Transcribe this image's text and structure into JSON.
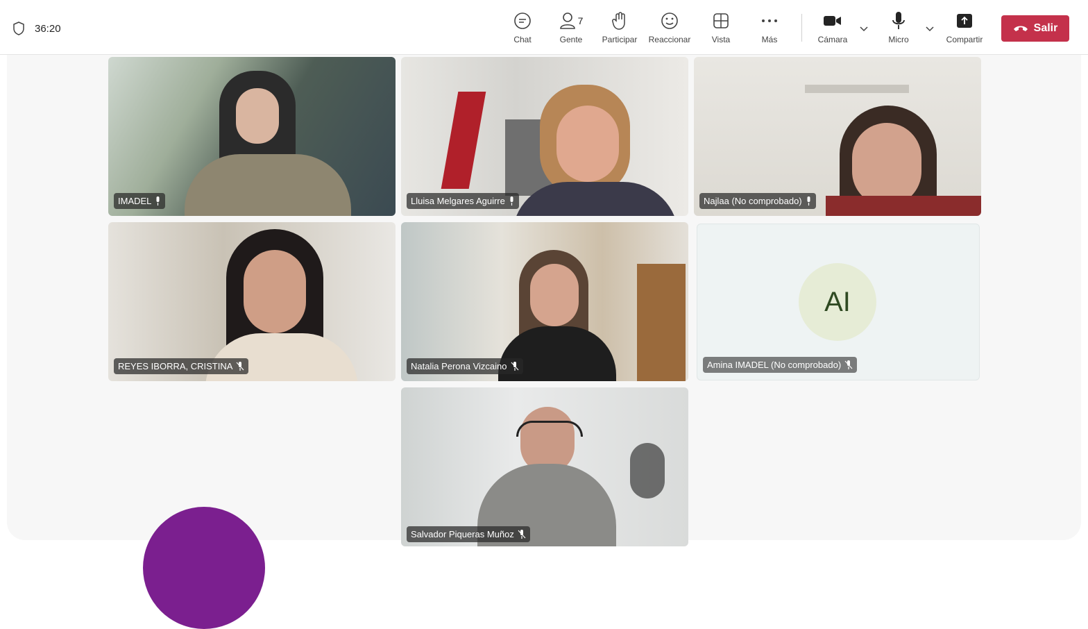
{
  "meeting": {
    "timer": "36:20"
  },
  "toolbar": {
    "chat_label": "Chat",
    "people_label": "Gente",
    "people_count": "7",
    "raise_label": "Participar",
    "react_label": "Reaccionar",
    "view_label": "Vista",
    "more_label": "Más",
    "camera_label": "Cámara",
    "mic_label": "Micro",
    "share_label": "Compartir",
    "leave_label": "Salir"
  },
  "participants": [
    {
      "name": "IMADEL",
      "mic": "on"
    },
    {
      "name": "Lluisa Melgares Aguirre",
      "mic": "on"
    },
    {
      "name": "Najlaa (No comprobado)",
      "mic": "on"
    },
    {
      "name": "REYES IBORRA, CRISTINA",
      "mic": "muted"
    },
    {
      "name": "Natalia Perona Vizcaino",
      "mic": "muted"
    },
    {
      "name": "Amina IMADEL (No comprobado)",
      "mic": "muted",
      "initials": "AI"
    },
    {
      "name": "Salvador Piqueras Muñoz",
      "mic": "muted"
    }
  ],
  "colors": {
    "leave": "#c4314b",
    "accent_purple": "#7b1f8f"
  }
}
